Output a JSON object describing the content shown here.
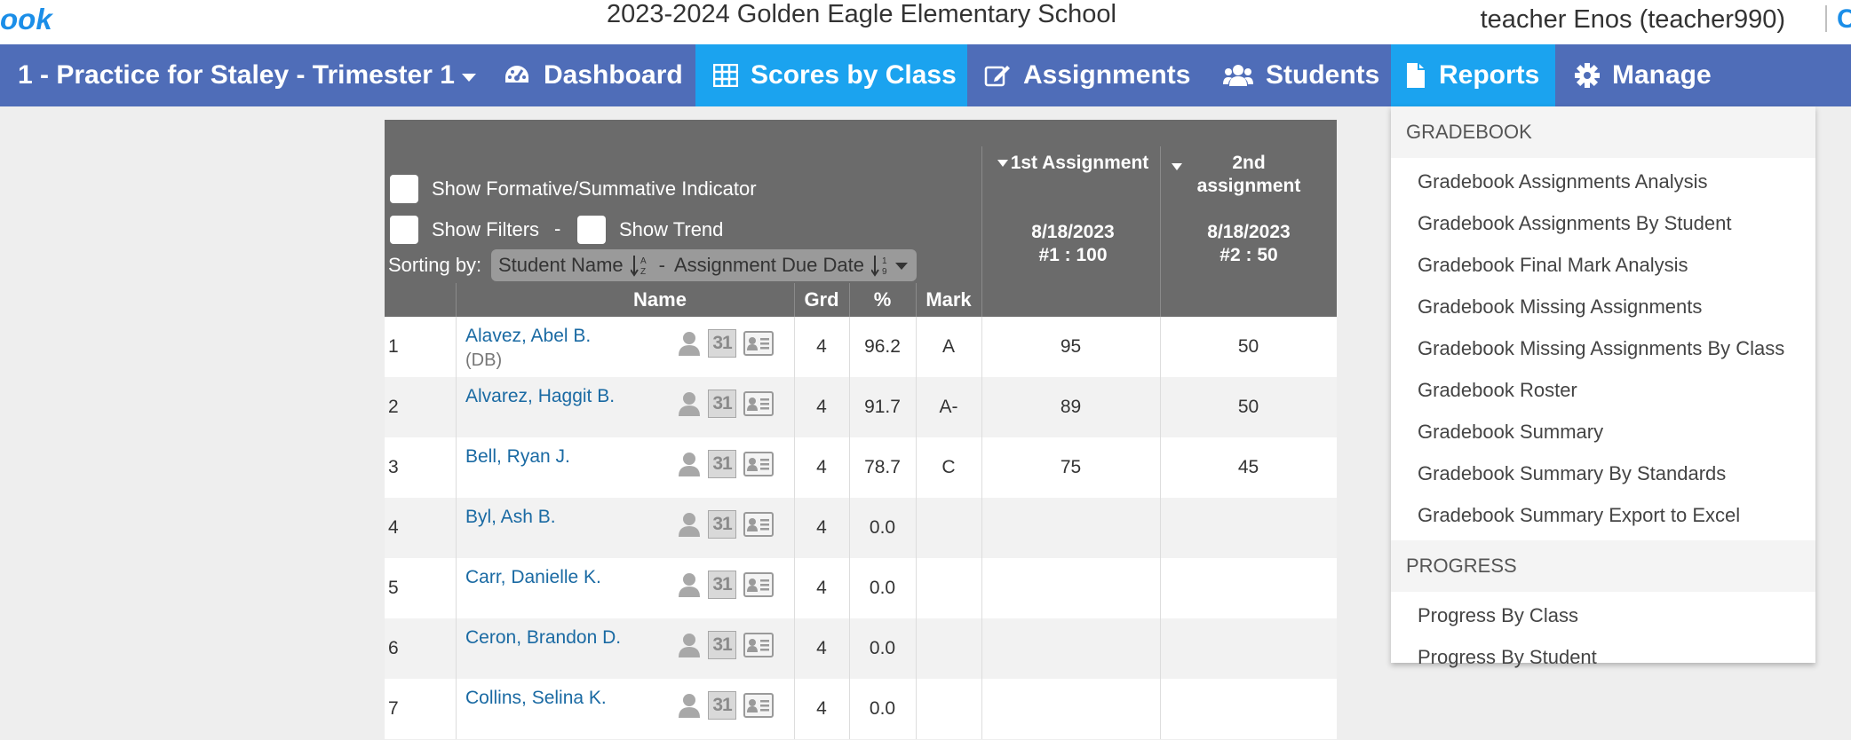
{
  "header": {
    "logo_fragment": "ook",
    "school_title": "2023-2024 Golden Eagle Elementary School",
    "user_label": "teacher Enos (teacher990)",
    "right_edge_glyph": "C"
  },
  "nav": {
    "class_selector": "1 - Practice for Staley - Trimester 1",
    "items": [
      {
        "label": "Dashboard",
        "icon": "dashboard-icon"
      },
      {
        "label": "Scores by Class",
        "icon": "table-icon",
        "active": true
      },
      {
        "label": "Assignments",
        "icon": "edit-icon"
      },
      {
        "label": "Students",
        "icon": "users-icon"
      },
      {
        "label": "Reports",
        "icon": "file-icon",
        "active": true
      },
      {
        "label": "Manage",
        "icon": "gear-icon"
      }
    ],
    "active_color": "#1ba3ef",
    "bar_color": "#4f6db8"
  },
  "options": {
    "formative_summative": "Show Formative/Summative Indicator",
    "filters": "Show Filters",
    "separator": "-",
    "trend": "Show Trend",
    "sorting_label": "Sorting by:",
    "sort_primary": "Student Name",
    "sort_separator": "-",
    "sort_secondary": "Assignment Due Date"
  },
  "columns": {
    "name": "Name",
    "grade": "Grd",
    "percent": "%",
    "mark": "Mark"
  },
  "assignments": [
    {
      "title": "1st Assignment",
      "date": "8/18/2023",
      "points": "#1 : 100"
    },
    {
      "title_line1": "2nd",
      "title_line2": "assignment",
      "date": "8/18/2023",
      "points": "#2 : 50"
    }
  ],
  "icons": {
    "calendar_text": "31"
  },
  "students": [
    {
      "num": "1",
      "name": "Alavez, Abel B.",
      "note": "(DB)",
      "grd": "4",
      "pct": "96.2",
      "mark": "A",
      "a1": "95",
      "a2": "50"
    },
    {
      "num": "2",
      "name": "Alvarez, Haggit B.",
      "note": "",
      "grd": "4",
      "pct": "91.7",
      "mark": "A-",
      "a1": "89",
      "a2": "50"
    },
    {
      "num": "3",
      "name": "Bell, Ryan J.",
      "note": "",
      "grd": "4",
      "pct": "78.7",
      "mark": "C",
      "a1": "75",
      "a2": "45"
    },
    {
      "num": "4",
      "name": "Byl, Ash B.",
      "note": "",
      "grd": "4",
      "pct": "0.0",
      "mark": "",
      "a1": "",
      "a2": ""
    },
    {
      "num": "5",
      "name": "Carr, Danielle K.",
      "note": "",
      "grd": "4",
      "pct": "0.0",
      "mark": "",
      "a1": "",
      "a2": ""
    },
    {
      "num": "6",
      "name": "Ceron, Brandon D.",
      "note": "",
      "grd": "4",
      "pct": "0.0",
      "mark": "",
      "a1": "",
      "a2": ""
    },
    {
      "num": "7",
      "name": "Collins, Selina K.",
      "note": "",
      "grd": "4",
      "pct": "0.0",
      "mark": "",
      "a1": "",
      "a2": ""
    }
  ],
  "reports_menu": {
    "sections": [
      {
        "title": "GRADEBOOK",
        "items": [
          "Gradebook Assignments Analysis",
          "Gradebook Assignments By Student",
          "Gradebook Final Mark Analysis",
          "Gradebook Missing Assignments",
          "Gradebook Missing Assignments By Class",
          "Gradebook Roster",
          "Gradebook Summary",
          "Gradebook Summary By Standards",
          "Gradebook Summary Export to Excel"
        ]
      },
      {
        "title": "PROGRESS",
        "items": [
          "Progress By Class",
          "Progress By Student"
        ]
      }
    ]
  }
}
